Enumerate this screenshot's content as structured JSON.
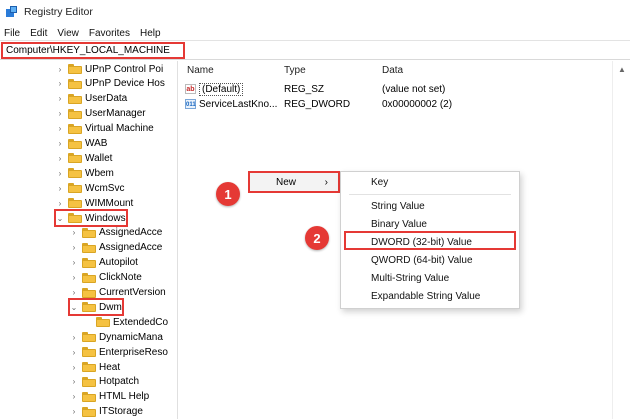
{
  "window": {
    "title": "Registry Editor",
    "icon": "registry-editor-icon"
  },
  "menu": [
    "File",
    "Edit",
    "View",
    "Favorites",
    "Help"
  ],
  "address": {
    "value": "Computer\\HKEY_LOCAL_MACHINE"
  },
  "tree": {
    "items": [
      {
        "label": "UPnP Control Poi",
        "level": 1,
        "expanded": false
      },
      {
        "label": "UPnP Device Hos",
        "level": 1,
        "expanded": false
      },
      {
        "label": "UserData",
        "level": 1,
        "expanded": false
      },
      {
        "label": "UserManager",
        "level": 1,
        "expanded": false
      },
      {
        "label": "Virtual Machine",
        "level": 1,
        "expanded": false
      },
      {
        "label": "WAB",
        "level": 1,
        "expanded": false
      },
      {
        "label": "Wallet",
        "level": 1,
        "expanded": false
      },
      {
        "label": "Wbem",
        "level": 1,
        "expanded": false
      },
      {
        "label": "WcmSvc",
        "level": 1,
        "expanded": false
      },
      {
        "label": "WIMMount",
        "level": 1,
        "expanded": false
      },
      {
        "label": "Windows",
        "level": 1,
        "expanded": true,
        "highlighted": true
      },
      {
        "label": "AssignedAcce",
        "level": 2,
        "expanded": false
      },
      {
        "label": "AssignedAcce",
        "level": 2,
        "expanded": false
      },
      {
        "label": "Autopilot",
        "level": 2,
        "expanded": false
      },
      {
        "label": "ClickNote",
        "level": 2,
        "expanded": false
      },
      {
        "label": "CurrentVersion",
        "level": 2,
        "expanded": false
      },
      {
        "label": "Dwm",
        "level": 2,
        "expanded": true,
        "highlighted": true
      },
      {
        "label": "ExtendedCo",
        "level": 3,
        "expanded": false,
        "leaf": true
      },
      {
        "label": "DynamicMana",
        "level": 2,
        "expanded": false
      },
      {
        "label": "EnterpriseReso",
        "level": 2,
        "expanded": false
      },
      {
        "label": "Heat",
        "level": 2,
        "expanded": false
      },
      {
        "label": "Hotpatch",
        "level": 2,
        "expanded": false
      },
      {
        "label": "HTML Help",
        "level": 2,
        "expanded": false
      },
      {
        "label": "ITStorage",
        "level": 2,
        "expanded": false
      }
    ]
  },
  "columns": {
    "name": "Name",
    "type": "Type",
    "data": "Data"
  },
  "values": [
    {
      "icon": "string-value-icon",
      "icon_text": "ab",
      "name": "(Default)",
      "type": "REG_SZ",
      "data": "(value not set)"
    },
    {
      "icon": "binary-value-icon",
      "icon_text": "011",
      "name": "ServiceLastKno...",
      "type": "REG_DWORD",
      "data": "0x00000002 (2)"
    }
  ],
  "context_menu": {
    "new_label": "New",
    "new_arrow": "›"
  },
  "submenu": {
    "items": [
      "Key",
      "String Value",
      "Binary Value",
      "DWORD (32-bit) Value",
      "QWORD (64-bit) Value",
      "Multi-String Value",
      "Expandable String Value"
    ],
    "highlighted": "DWORD (32-bit) Value"
  },
  "badges": [
    "1",
    "2"
  ],
  "colors": {
    "highlight": "#e53935",
    "folder": "#f5c242",
    "badge": "#e53935"
  }
}
